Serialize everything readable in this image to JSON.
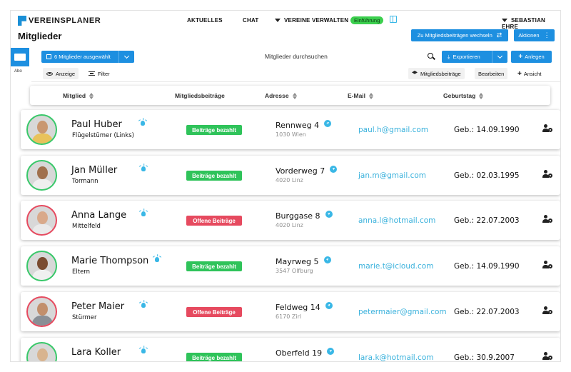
{
  "brand": {
    "name": "VEREINSPLANER"
  },
  "nav": {
    "aktuelles": "AKTUELLES",
    "chat": "CHAT",
    "vereine": "VEREINE VERWALTEN",
    "einfuehrung": "Einführung",
    "user": "SEBASTIAN EHRE"
  },
  "page": {
    "title": "Mitglieder",
    "beitraege_button": "Zu Mitgliedsbeiträgen wechseln",
    "aktionen_button": "Aktionen"
  },
  "sidebar": {
    "label": "Abo"
  },
  "toolbar": {
    "selected": "6 Mitglieder ausgewählt",
    "search_placeholder": "Mitglieder durchsuchen",
    "exportieren": "Exportieren",
    "anlegen": "Anlegen",
    "anzeige": "Anzeige",
    "filter": "Filter",
    "mitgliedsbeitraege": "Mitgliedsbeiträge",
    "bearbeiten": "Bearbeiten",
    "ansicht": "Ansicht"
  },
  "columns": {
    "mitglied": "Mitglied",
    "beitraege": "Mitgliedsbeiträge",
    "adresse": "Adresse",
    "email": "E-Mail",
    "geburtstag": "Geburtstag"
  },
  "colors": {
    "accent": "#1d8fe0",
    "paid": "#2fc35a",
    "open": "#e64a5f",
    "link": "#39b1dc"
  },
  "members": [
    {
      "name": "Paul Huber",
      "role": "Flügelstümer (Links)",
      "status": "Beiträge bezahlt",
      "status_type": "paid",
      "street": "Rennweg 4",
      "city": "1030 Wien",
      "email": "paul.h@gmail.com",
      "birthday": "Geb.: 14.09.1990"
    },
    {
      "name": "Jan Müller",
      "role": "Tormann",
      "status": "Beiträge bezahlt",
      "status_type": "paid",
      "street": "Vorderweg 7",
      "city": "4020 Linz",
      "email": "jan.m@gmail.com",
      "birthday": "Geb.: 02.03.1995"
    },
    {
      "name": "Anna Lange",
      "role": "Mittelfeld",
      "status": "Offene Beiträge",
      "status_type": "open",
      "street": "Burggase 8",
      "city": "4020 Linz",
      "email": "anna.l@hotmail.com",
      "birthday": "Geb.: 22.07.2003"
    },
    {
      "name": "Marie Thompson",
      "role": "Eltern",
      "status": "Beiträge bezahlt",
      "status_type": "paid",
      "street": "Mayrweg 5",
      "city": "3547 Olfburg",
      "email": "marie.t@icloud.com",
      "birthday": "Geb.: 14.09.1990"
    },
    {
      "name": "Peter Maier",
      "role": "Stürmer",
      "status": "Offene Beiträge",
      "status_type": "open",
      "street": "Feldweg 14",
      "city": "6170 Zirl",
      "email": "petermaier@gmail.com",
      "birthday": "Geb.: 22.07.2003"
    },
    {
      "name": "Lara Koller",
      "role": "",
      "status": "Beiträge bezahlt",
      "status_type": "paid",
      "street": "Oberfeld 19",
      "city": "",
      "email": "lara.k@hotmail.com",
      "birthday": "Geb.: 30.9.2007"
    }
  ]
}
